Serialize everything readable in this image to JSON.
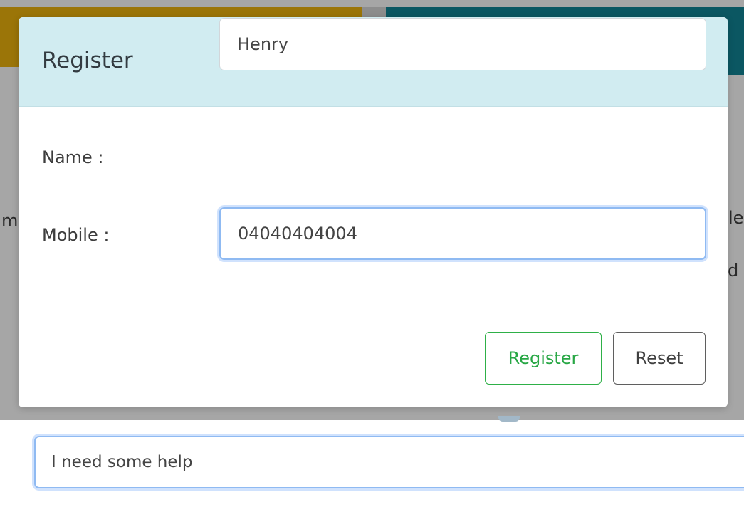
{
  "modal": {
    "title": "Register",
    "close_symbol": "×",
    "fields": {
      "name": {
        "label": "Name :",
        "value": "Henry"
      },
      "mobile": {
        "label": "Mobile :",
        "value": "04040404004"
      }
    },
    "buttons": {
      "register": "Register",
      "reset": "Reset"
    }
  },
  "chat": {
    "input_value": "I need some help"
  },
  "background_fragments": {
    "left_m": "m",
    "right_le": "le",
    "right_d": "d"
  },
  "colors": {
    "header_bg": "#d1ecf1",
    "success": "#28a745",
    "focus": "#8fbaf2",
    "bg_yellow": "#9b7508",
    "bg_teal": "#0b5762"
  },
  "icons": {
    "close": "close-icon"
  }
}
